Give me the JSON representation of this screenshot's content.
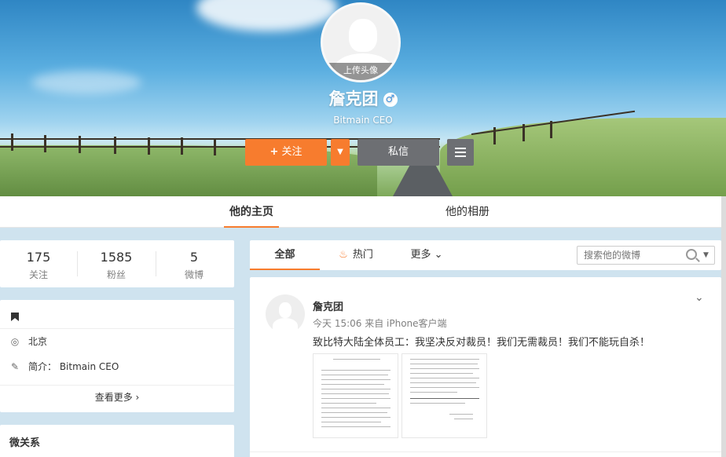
{
  "profile": {
    "avatar_upload_label": "上传头像",
    "name": "詹克团",
    "gender_symbol": "♂",
    "title": "Bitmain CEO",
    "follow_label": "关注",
    "follow_plus": "+",
    "follow_dropdown": "▼",
    "message_label": "私信"
  },
  "tabs": {
    "home": "他的主页",
    "album": "他的相册"
  },
  "stats": [
    {
      "value": "175",
      "label": "关注"
    },
    {
      "value": "1585",
      "label": "粉丝"
    },
    {
      "value": "5",
      "label": "微博"
    }
  ],
  "info": {
    "location_icon": "◎",
    "location": "北京",
    "bio_icon": "✎",
    "bio": "简介： Bitmain CEO",
    "more_label": "查看更多 ›"
  },
  "relations": {
    "title": "微关系"
  },
  "feed_tabs": {
    "all": "全部",
    "hot_icon": "♨",
    "hot": "热门",
    "more": "更多 ⌄"
  },
  "search": {
    "placeholder": "搜索他的微博",
    "dropdown": "▼"
  },
  "post": {
    "author": "詹克团",
    "meta": "今天 15:06 来自 iPhone客户端",
    "text": "致比特大陆全体员工：我坚决反对裁员！我们无需裁员！我们不能玩自杀！",
    "chevron": "⌄"
  },
  "colors": {
    "accent": "#f77c2e",
    "secondary_button": "#6d6f73",
    "page_bg": "#cfe3ef"
  }
}
